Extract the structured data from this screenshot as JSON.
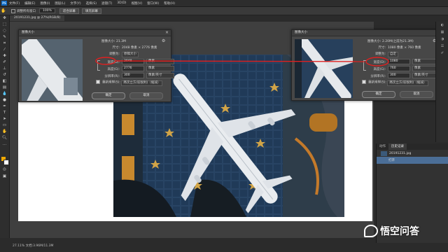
{
  "menu": [
    "PS",
    "文件(F)",
    "编辑(E)",
    "图像(I)",
    "图层(L)",
    "文字(Y)",
    "选择(S)",
    "滤镜(T)",
    "3D(D)",
    "视图(V)",
    "窗口(W)",
    "帮助(H)"
  ],
  "options": {
    "checkbox_label": "调整所有窗口",
    "zoom_value": "100%",
    "fit_label": "适合屏幕",
    "fill_label": "填充屏幕"
  },
  "tab": "20191231.jpg @ 27%(RGB/8)",
  "status": "27.11%  文档:3.96M/11.3M",
  "dialog_left": {
    "title": "图像大小",
    "image_size_label": "图像大小:",
    "image_size_value": "21.3M",
    "dims_label": "尺寸:",
    "dims_value": "2048 像素 × 2776 像素",
    "fit_label": "调整为:",
    "fit_value": "原稿大小",
    "width_label": "宽度(D):",
    "width_value": "2048",
    "width_unit": "像素",
    "height_label": "高度(G):",
    "height_value": "2776",
    "height_unit": "像素",
    "res_label": "分辨率(R):",
    "res_value": "300",
    "res_unit": "像素/英寸",
    "resample_label": "重新采样(S):",
    "resample_value": "两次立方(较锐利)（缩减）",
    "ok": "确定",
    "cancel": "取消"
  },
  "dialog_right": {
    "title": "图像大小",
    "image_size_label": "图像大小:",
    "image_size_value": "2.20M(之前为21.3M)",
    "dims_label": "尺寸:",
    "dims_value": "1080 像素 × 760 像素",
    "fit_label": "调整为:",
    "fit_value": "自定",
    "width_label": "宽度(D):",
    "width_value": "1080",
    "width_unit": "像素",
    "height_label": "高度(G):",
    "height_value": "760",
    "height_unit": "像素",
    "res_label": "分辨率(R):",
    "res_value": "300",
    "res_unit": "像素/英寸",
    "resample_label": "重新采样(S):",
    "resample_value": "两次立方(较锐利)（缩减）",
    "ok": "确定",
    "cancel": "取消"
  },
  "panel": {
    "tabs": [
      "历史记录",
      "动作"
    ],
    "history_file": "20191231.jpg",
    "history_step": "打开"
  },
  "watermark": "悟空问答",
  "colors": {
    "annotation": "#e02020",
    "photo_bg": "#1f3550",
    "plane": "#e9ecef"
  }
}
